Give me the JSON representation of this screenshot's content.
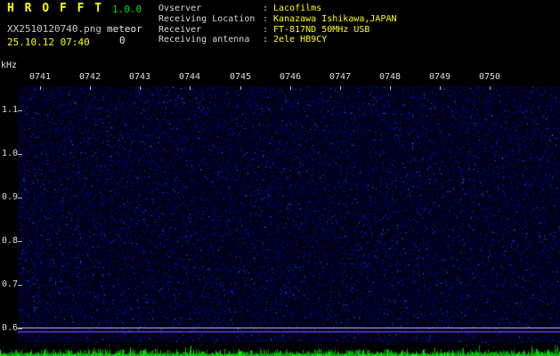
{
  "app": {
    "title": "H R O F F T",
    "version": "1.0.0",
    "filename": "XX2510120740.png",
    "mode": "meteor",
    "count": "0",
    "datetime": "25.10.12 07:40"
  },
  "info": {
    "separator": ":",
    "rows": [
      {
        "label": "Ovserver",
        "value": "Lacofilms"
      },
      {
        "label": "Receiving Location",
        "value": "Kanazawa Ishikawa,JAPAN"
      },
      {
        "label": "Receiver",
        "value": "FT-817ND 50MHz USB"
      },
      {
        "label": "Receiving antenna",
        "value": "2ele HB9CY"
      }
    ]
  },
  "spectrogram": {
    "ylabel": "kHz",
    "yticks": [
      "1.1",
      "1.0",
      "0.9",
      "0.8",
      "0.7",
      "0.6"
    ],
    "xticks": [
      "0741",
      "0742",
      "0743",
      "0744",
      "0745",
      "0746",
      "0747",
      "0748",
      "0749",
      "0750"
    ],
    "threshold_line_top_color": "#c8c8ea",
    "threshold_line_bottom_color": "#6a3cc8"
  },
  "colors": {
    "title": "#ffff00",
    "version": "#00e400",
    "values": "#ffff00",
    "labels": "#d8d8d8",
    "noise_green": "#00c800",
    "background": "#000000"
  }
}
